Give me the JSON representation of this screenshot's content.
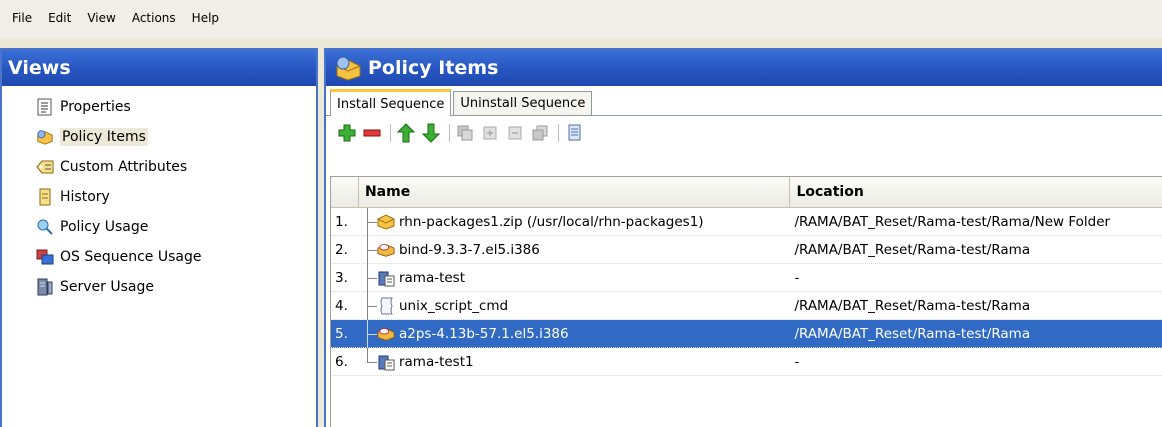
{
  "menu": [
    "File",
    "Edit",
    "View",
    "Actions",
    "Help"
  ],
  "views": {
    "title": "Views",
    "items": [
      {
        "label": "Properties",
        "icon": "properties-icon"
      },
      {
        "label": "Policy Items",
        "icon": "policy-items-icon",
        "selected": true
      },
      {
        "label": "Custom Attributes",
        "icon": "custom-attributes-icon"
      },
      {
        "label": "History",
        "icon": "history-icon"
      },
      {
        "label": "Policy Usage",
        "icon": "policy-usage-icon"
      },
      {
        "label": "OS Sequence Usage",
        "icon": "os-sequence-usage-icon"
      },
      {
        "label": "Server Usage",
        "icon": "server-usage-icon"
      }
    ]
  },
  "policy": {
    "title": "Policy Items",
    "tabs": [
      {
        "label": "Install Sequence",
        "active": true
      },
      {
        "label": "Uninstall Sequence",
        "active": false
      }
    ],
    "toolbar": [
      "add-icon",
      "remove-icon",
      "move-up-icon",
      "move-down-icon",
      "expand-disabled-icon",
      "plus-disabled-icon",
      "minus-disabled-icon",
      "collapse-disabled-icon",
      "notes-icon"
    ],
    "columns": {
      "name": "Name",
      "location": "Location"
    },
    "rows": [
      {
        "num": "1.",
        "name": "rhn-packages1.zip (/usr/local/rhn-packages1)",
        "location": "/RAMA/BAT_Reset/Rama-test/Rama/New Folder",
        "icon": "zip-package-icon"
      },
      {
        "num": "2.",
        "name": "bind-9.3.3-7.el5.i386",
        "location": "/RAMA/BAT_Reset/Rama-test/Rama",
        "icon": "rpm-package-icon"
      },
      {
        "num": "3.",
        "name": "rama-test",
        "location": "-",
        "icon": "server-script-icon"
      },
      {
        "num": "4.",
        "name": "unix_script_cmd",
        "location": "/RAMA/BAT_Reset/Rama-test/Rama",
        "icon": "script-icon"
      },
      {
        "num": "5.",
        "name": "a2ps-4.13b-57.1.el5.i386",
        "location": "/RAMA/BAT_Reset/Rama-test/Rama",
        "icon": "rpm-package-icon",
        "selected": true
      },
      {
        "num": "6.",
        "name": "rama-test1",
        "location": "-",
        "icon": "server-script-icon"
      }
    ]
  }
}
